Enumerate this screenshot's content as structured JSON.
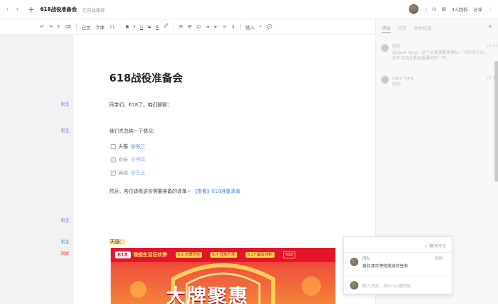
{
  "topbar": {
    "back": "‹",
    "forward": "›",
    "add": "+",
    "title": "618战役准备会",
    "save_status": "已自动保存",
    "collab": "4人协作",
    "share": "分享",
    "more": "⋮"
  },
  "toolbar": {
    "undo": "↶",
    "redo": "↷",
    "format_painter": "T",
    "clear": "⌫",
    "style": "正文",
    "font": "字体",
    "size": "11",
    "bold": "B",
    "italic": "I",
    "underline": "U",
    "strike": "S",
    "font_color": "A",
    "highlight": "🖉",
    "list_ul": "☰",
    "list_ol": "☰",
    "checklist": "☑",
    "indent_in": "⇥",
    "indent_out": "⇤",
    "align": "≡",
    "line_spacing": "↕",
    "insert": "插入",
    "find": "⌕",
    "comment_tool": "💬"
  },
  "doc": {
    "heading": "618战役准备会",
    "para1": "同学们，618了，咱们聊聊：",
    "para2": "我们先总结一下情况：",
    "tasks": [
      {
        "label": "天猫",
        "mention": "@张三",
        "done": false
      },
      {
        "label": "京东",
        "mention": "@李四",
        "done": true
      },
      {
        "label": "其他",
        "mention": "@王五",
        "done": true
      }
    ],
    "para3_prefix": "然后，各位请看这份需要准备的清单~",
    "para3_link": "【查看】618准备清单",
    "highlight_text": "天猫：",
    "comment_marks": [
      "批注",
      "批注",
      "批注",
      "批注",
      "回复"
    ]
  },
  "banner": {
    "logo": "618",
    "slogan": "理想生活狂欢季",
    "promos": [
      "6.1 大牌开抢",
      "6.7 狂欢开场",
      "6.17 最后冲刺",
      "618"
    ],
    "big_text": "大牌聚惠"
  },
  "rightpanel": {
    "tabs": [
      "评论",
      "历史",
      "文档信息"
    ],
    "close": "✕",
    "comments": [
      {
        "author": "团队",
        "text": "@Leon Tang，这个文案需要再确认一下时间节点，另外活动主推品类要同步一下。",
        "time": "10:21"
      },
      {
        "author": "Leon Tang",
        "text": "好的",
        "time": "10:35"
      }
    ]
  },
  "popup": {
    "resolve": "✓ 解决评论",
    "author": "团队",
    "text": "各位请尽快完成对应任务",
    "time": "刚刚",
    "input_placeholder": "输入回复，按Enter键回复"
  }
}
